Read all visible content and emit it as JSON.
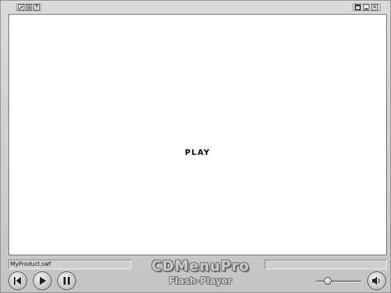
{
  "titlebar": {
    "left_icons": [
      "pencil-icon",
      "list-icon",
      "help-icon"
    ],
    "help_glyph": "?",
    "right_icons": [
      "window-icon",
      "minimize-icon",
      "close-icon"
    ],
    "close_glyph": "×"
  },
  "stage": {
    "center_text": "PLAY"
  },
  "status": {
    "filename": "MyProduct.swf",
    "right_field": ""
  },
  "brand": {
    "line1": "CDMenuPro",
    "line2": "Flash-Player"
  },
  "controls": {
    "buttons": [
      "rewind-icon",
      "play-icon",
      "pause-icon",
      "speaker-icon"
    ],
    "volume_level": 0.25
  }
}
